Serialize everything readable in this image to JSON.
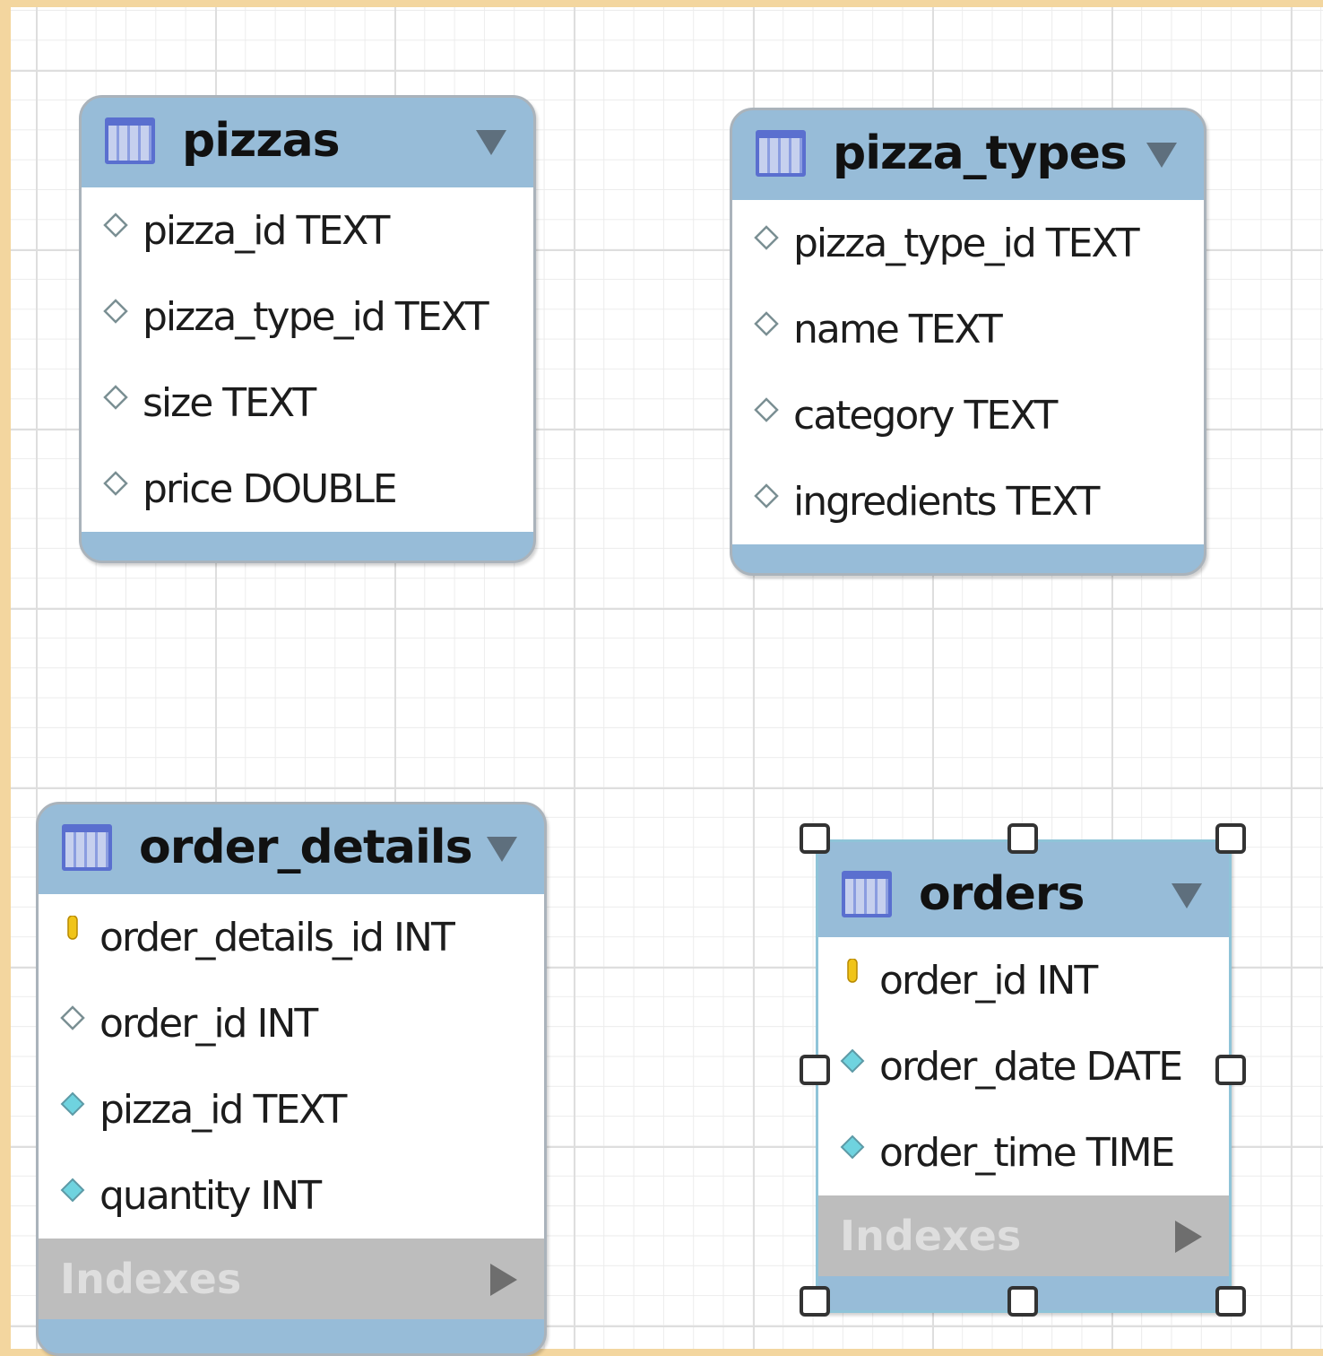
{
  "colors": {
    "page_border": "#f3d69f",
    "table_header": "#97bcd8",
    "indexes_section": "#bdbdbd",
    "nullable_icon": "#ffffff",
    "foreign_key_icon": "#6fd3df",
    "primary_key_icon": "#f0c419"
  },
  "tables": {
    "pizzas": {
      "name": "pizzas",
      "columns": [
        {
          "label": "pizza_id TEXT",
          "icon": "nullable-diamond-icon"
        },
        {
          "label": "pizza_type_id TEXT",
          "icon": "nullable-diamond-icon"
        },
        {
          "label": "size TEXT",
          "icon": "nullable-diamond-icon"
        },
        {
          "label": "price DOUBLE",
          "icon": "nullable-diamond-icon"
        }
      ]
    },
    "pizza_types": {
      "name": "pizza_types",
      "columns": [
        {
          "label": "pizza_type_id TEXT",
          "icon": "nullable-diamond-icon"
        },
        {
          "label": "name TEXT",
          "icon": "nullable-diamond-icon"
        },
        {
          "label": "category TEXT",
          "icon": "nullable-diamond-icon"
        },
        {
          "label": "ingredients TEXT",
          "icon": "nullable-diamond-icon"
        }
      ]
    },
    "order_details": {
      "name": "order_details",
      "columns": [
        {
          "label": "order_details_id INT",
          "icon": "primary-key-icon"
        },
        {
          "label": "order_id INT",
          "icon": "nullable-diamond-icon"
        },
        {
          "label": "pizza_id TEXT",
          "icon": "foreign-key-diamond-icon"
        },
        {
          "label": "quantity INT",
          "icon": "foreign-key-diamond-icon"
        }
      ],
      "indexes_label": "Indexes"
    },
    "orders": {
      "name": "orders",
      "columns": [
        {
          "label": "order_id INT",
          "icon": "primary-key-icon"
        },
        {
          "label": "order_date DATE",
          "icon": "foreign-key-diamond-icon"
        },
        {
          "label": "order_time TIME",
          "icon": "foreign-key-diamond-icon"
        }
      ],
      "indexes_label": "Indexes",
      "selected": true
    }
  }
}
